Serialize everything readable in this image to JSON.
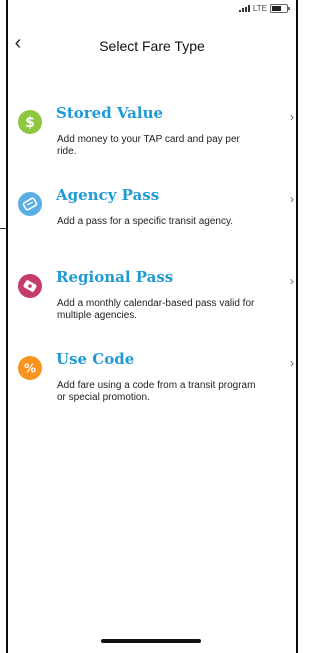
{
  "status_bar": {
    "network": "LTE"
  },
  "header": {
    "title": "Select Fare Type"
  },
  "fare_types": [
    {
      "title": "Stored Value",
      "description": "Add money to your TAP card and pay per ride.",
      "icon": "dollar-icon",
      "color": "#8dc63f"
    },
    {
      "title": "Agency Pass",
      "description": "Add a pass for a specific transit agency.",
      "icon": "ticket-icon",
      "color": "#5aaee3"
    },
    {
      "title": "Regional Pass",
      "description": "Add a monthly calendar-based pass valid for multiple agencies.",
      "icon": "pass-icon",
      "color": "#c43c6a"
    },
    {
      "title": "Use Code",
      "description": "Add fare using a code from a transit program or special promotion.",
      "icon": "percent-icon",
      "color": "#f7931e"
    }
  ]
}
